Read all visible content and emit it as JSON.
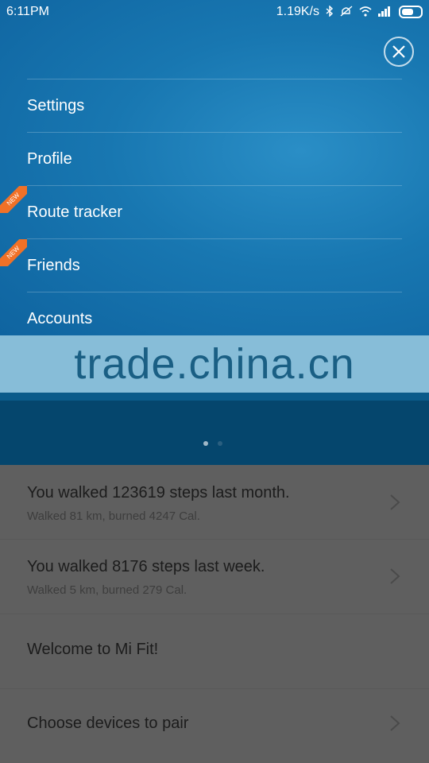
{
  "status_bar": {
    "time": "6:11PM",
    "speed": "1.19K/s",
    "icons": [
      "bluetooth-icon",
      "mute-icon",
      "wifi-icon",
      "signal-icon",
      "battery-icon"
    ]
  },
  "menu": {
    "close_icon": "close-icon",
    "items": [
      {
        "label": "Settings",
        "badge": ""
      },
      {
        "label": "Profile",
        "badge": ""
      },
      {
        "label": "Route tracker",
        "badge": "NEW"
      },
      {
        "label": "Friends",
        "badge": "NEW"
      },
      {
        "label": "Accounts",
        "badge": ""
      }
    ]
  },
  "watermark": "trade.china.cn",
  "feed": {
    "items": [
      {
        "title": "You walked 123619 steps last month.",
        "subtitle": "Walked 81 km, burned 4247 Cal."
      },
      {
        "title": "You walked 8176 steps last week.",
        "subtitle": "Walked 5 km, burned 279 Cal."
      },
      {
        "title": "Welcome to Mi Fit!",
        "subtitle": ""
      },
      {
        "title": "Choose devices to pair",
        "subtitle": ""
      }
    ]
  },
  "colors": {
    "menu_blue": "#1877b1",
    "badge_orange": "#f07127",
    "watermark_band": "#89c2de",
    "dark_band": "#05466d"
  }
}
